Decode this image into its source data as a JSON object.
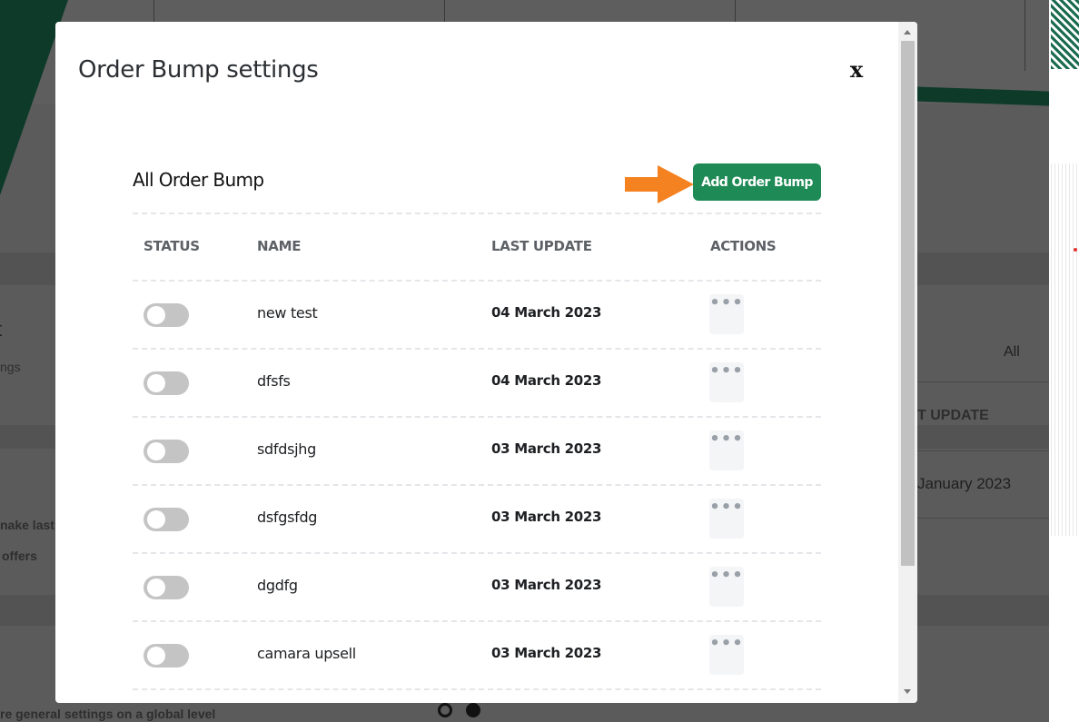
{
  "background": {
    "fragments": [
      "t",
      "ngs",
      "nake last",
      "offers",
      "All",
      "T UPDATE",
      "January 2023",
      "re general settings on a global level"
    ]
  },
  "modal": {
    "title": "Order Bump settings",
    "close_label": "x",
    "section_title": "All Order Bump",
    "add_button_label": "Add Order Bump",
    "columns": [
      "STATUS",
      "NAME",
      "LAST UPDATE",
      "ACTIONS"
    ],
    "rows": [
      {
        "status": "off",
        "name": "new test",
        "last_update": "04 March 2023",
        "actions": "•••"
      },
      {
        "status": "off",
        "name": "dfsfs",
        "last_update": "04 March 2023",
        "actions": "•••"
      },
      {
        "status": "off",
        "name": "sdfdsjhg",
        "last_update": "03 March 2023",
        "actions": "•••"
      },
      {
        "status": "off",
        "name": "dsfgsfdg",
        "last_update": "03 March 2023",
        "actions": "•••"
      },
      {
        "status": "off",
        "name": "dgdfg",
        "last_update": "03 March 2023",
        "actions": "•••"
      },
      {
        "status": "off",
        "name": "camara upsell",
        "last_update": "03 March 2023",
        "actions": "•••"
      }
    ]
  },
  "colors": {
    "accent": "#1e8a55",
    "arrow": "#f58220",
    "overlay": "#5b5b5b",
    "brand_dark_green": "#0e3a2a"
  },
  "icons": [
    "close-icon",
    "arrow-right-icon",
    "more-dots-icon",
    "toggle-switch"
  ]
}
